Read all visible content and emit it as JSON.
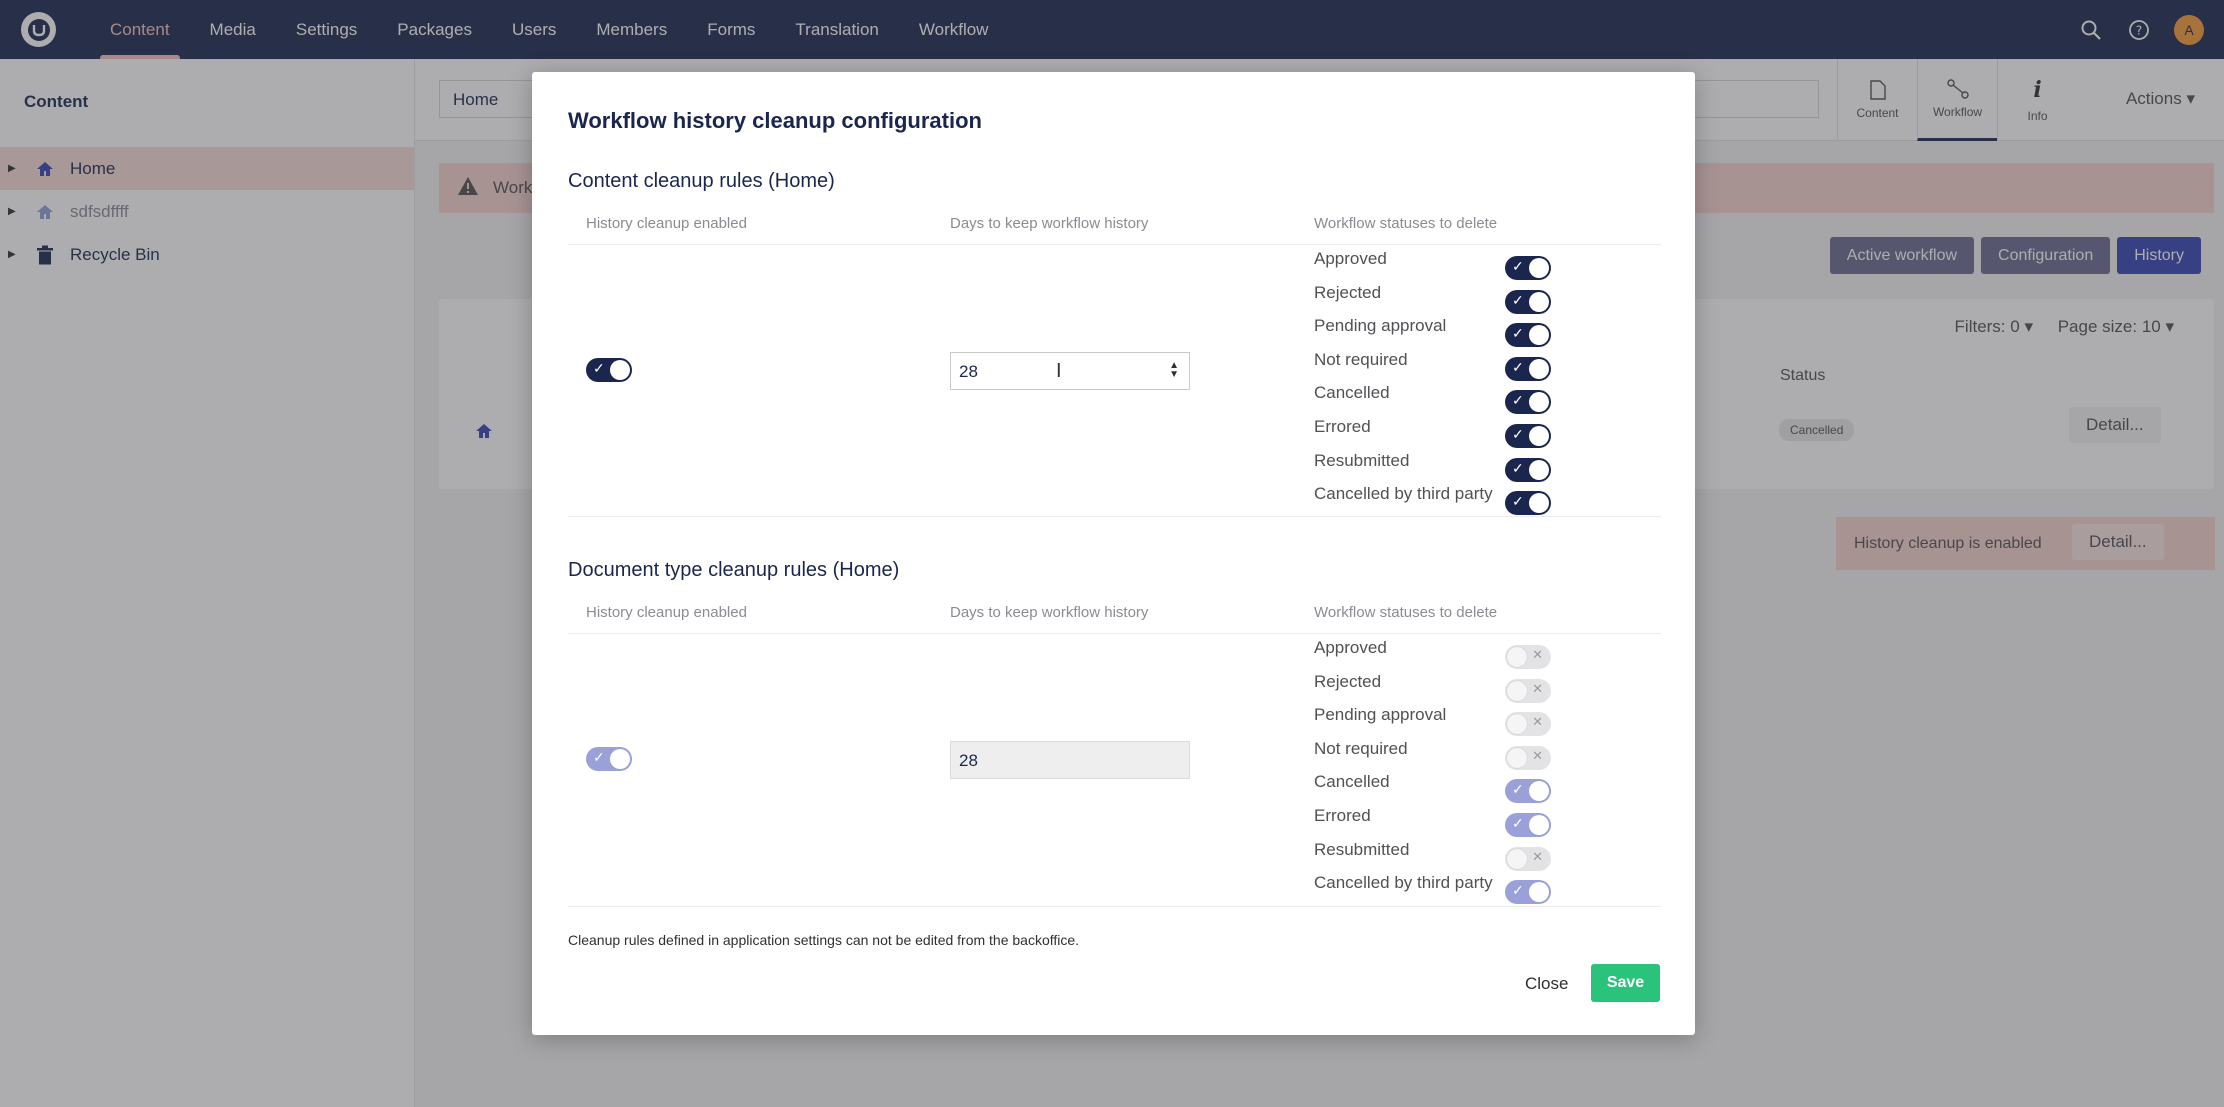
{
  "topnav": {
    "items": [
      "Content",
      "Media",
      "Settings",
      "Packages",
      "Users",
      "Members",
      "Forms",
      "Translation",
      "Workflow"
    ],
    "avatar_initial": "A"
  },
  "sidebar": {
    "title": "Content",
    "items": [
      {
        "label": "Home",
        "icon": "home-icon"
      },
      {
        "label": "sdfsdffff",
        "icon": "home-icon"
      },
      {
        "label": "Recycle Bin",
        "icon": "trash-icon"
      }
    ]
  },
  "editor": {
    "name_value": "Home",
    "app_tabs": [
      "Content",
      "Workflow",
      "Info"
    ],
    "actions_label": "Actions",
    "alert_text": "Work",
    "workflow_buttons": [
      "Active workflow",
      "Configuration",
      "History"
    ],
    "filters_label": "Filters: 0",
    "page_size_label": "Page size: 10",
    "status_header": "Status",
    "status_chip": "Cancelled",
    "detail_label": "Detail...",
    "cleanup_banner_text": "History cleanup is enabled"
  },
  "modal": {
    "title": "Workflow history cleanup configuration",
    "column_headers": {
      "enabled": "History cleanup enabled",
      "days": "Days to keep workflow history",
      "statuses": "Workflow statuses to delete"
    },
    "content_rules": {
      "title": "Content cleanup rules (Home)",
      "enabled": true,
      "days": "28",
      "statuses": [
        {
          "label": "Approved",
          "on": true
        },
        {
          "label": "Rejected",
          "on": true
        },
        {
          "label": "Pending approval",
          "on": true
        },
        {
          "label": "Not required",
          "on": true
        },
        {
          "label": "Cancelled",
          "on": true
        },
        {
          "label": "Errored",
          "on": true
        },
        {
          "label": "Resubmitted",
          "on": true
        },
        {
          "label": "Cancelled by third party",
          "on": true
        }
      ]
    },
    "doctype_rules": {
      "title": "Document type cleanup rules (Home)",
      "enabled": true,
      "days": "28",
      "statuses": [
        {
          "label": "Approved",
          "on": false
        },
        {
          "label": "Rejected",
          "on": false
        },
        {
          "label": "Pending approval",
          "on": false
        },
        {
          "label": "Not required",
          "on": false
        },
        {
          "label": "Cancelled",
          "on": true
        },
        {
          "label": "Errored",
          "on": true
        },
        {
          "label": "Resubmitted",
          "on": false
        },
        {
          "label": "Cancelled by third party",
          "on": true
        }
      ]
    },
    "footnote": "Cleanup rules defined in application settings can not be edited from the backoffice.",
    "close_label": "Close",
    "save_label": "Save"
  },
  "colors": {
    "nav_bg": "#1b264f",
    "accent": "#f5c1bc",
    "save": "#2bc37c",
    "toggle_on": "#1b264f",
    "toggle_disabled_on": "#9aa0d8"
  }
}
